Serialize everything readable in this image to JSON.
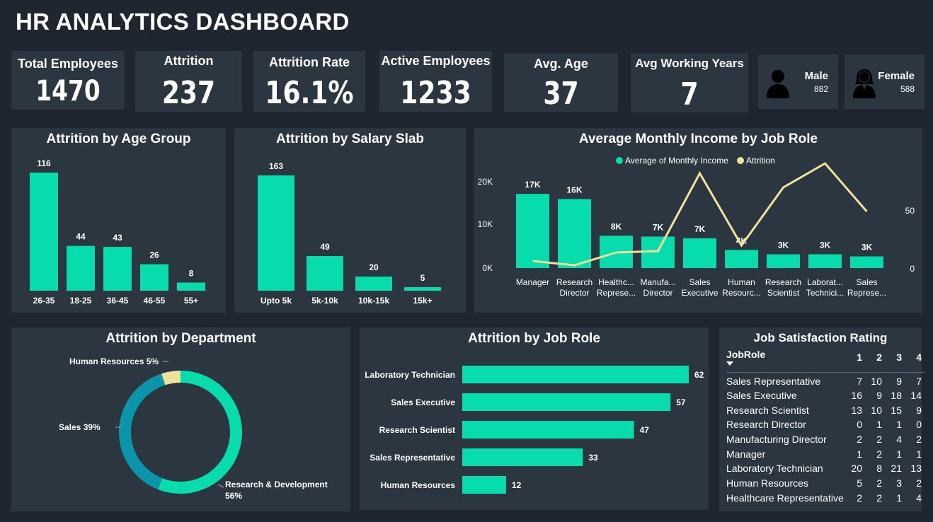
{
  "page": {
    "title": "HR ANALYTICS DASHBOARD"
  },
  "colors": {
    "background": "#1f2630",
    "card": "#2b3640",
    "accent": "#07dcac",
    "line": "#efe39b",
    "donut_sales": "#0b95ab",
    "donut_hr": "#efe39b"
  },
  "kpis": [
    {
      "label": "Total Employees",
      "value": "1470"
    },
    {
      "label": "Attrition",
      "value": "237"
    },
    {
      "label": "Attrition Rate",
      "value": "16.1%"
    },
    {
      "label": "Active Employees",
      "value": "1233"
    },
    {
      "label": "Avg. Age",
      "value": "37"
    },
    {
      "label": "Avg Working Years",
      "value": "7"
    }
  ],
  "gender": {
    "male": {
      "label": "Male",
      "value": "882",
      "icon": "male-user-icon"
    },
    "female": {
      "label": "Female",
      "value": "588",
      "icon": "female-user-icon"
    }
  },
  "chart_data": [
    {
      "type": "bar",
      "title": "Attrition by Age Group",
      "categories": [
        "26-35",
        "18-25",
        "36-45",
        "46-55",
        "55+"
      ],
      "values": [
        116,
        44,
        43,
        26,
        8
      ]
    },
    {
      "type": "bar",
      "title": "Attrition by Salary Slab",
      "categories": [
        "Upto 5k",
        "5k-10k",
        "10k-15k",
        "15k+"
      ],
      "values": [
        163,
        49,
        20,
        5
      ]
    },
    {
      "type": "bar",
      "title": "Average Monthly Income by Job Role",
      "categories": [
        "Manager",
        "Research Director",
        "Healthc... Represe...",
        "Manufa... Director",
        "Sales Executive",
        "Human Resourc...",
        "Research Scientist",
        "Laborat... Technici...",
        "Sales Represe..."
      ],
      "legend": [
        "Average of Monthly Income",
        "Attrition"
      ],
      "y_ticks_left": [
        "20K",
        "10K",
        "0K"
      ],
      "y_ticks_right": [
        "50",
        "0"
      ],
      "ylim_left": [
        0,
        20000
      ],
      "ylim_right": [
        0,
        60
      ],
      "series": [
        {
          "name": "Average of Monthly Income",
          "type": "bar",
          "values": [
            17200,
            16000,
            7500,
            7300,
            6900,
            4200,
            3200,
            3200,
            2700
          ],
          "labels": [
            "17K",
            "16K",
            "8K",
            "7K",
            "7K",
            "4K",
            "3K",
            "3K",
            "3K"
          ]
        },
        {
          "name": "Attrition",
          "type": "line",
          "values": [
            5,
            2,
            11,
            12,
            67,
            16,
            57,
            74,
            40
          ]
        }
      ]
    },
    {
      "type": "pie",
      "title": "Attrition by Department",
      "categories": [
        "Research & Development",
        "Sales",
        "Human Resources"
      ],
      "values": [
        56,
        39,
        5
      ],
      "labels": [
        "Research & Development",
        "56%",
        "Sales 39%",
        "Human Resources 5%"
      ]
    },
    {
      "type": "bar",
      "title": "Attrition by Job Role",
      "categories": [
        "Laboratory Technician",
        "Sales Executive",
        "Research Scientist",
        "Sales Representative",
        "Human Resources"
      ],
      "values": [
        62,
        57,
        47,
        33,
        12
      ]
    },
    {
      "type": "table",
      "title": "Job Satisfaction Rating",
      "columns": [
        "JobRole",
        "1",
        "2",
        "3",
        "4"
      ],
      "rows": [
        [
          "Sales Representative",
          "7",
          "10",
          "9",
          "7"
        ],
        [
          "Sales Executive",
          "16",
          "9",
          "18",
          "14"
        ],
        [
          "Research Scientist",
          "13",
          "10",
          "15",
          "9"
        ],
        [
          "Research Director",
          "0",
          "1",
          "1",
          "0"
        ],
        [
          "Manufacturing Director",
          "2",
          "2",
          "4",
          "2"
        ],
        [
          "Manager",
          "1",
          "2",
          "1",
          "1"
        ],
        [
          "Laboratory Technician",
          "20",
          "8",
          "21",
          "13"
        ],
        [
          "Human Resources",
          "5",
          "2",
          "3",
          "2"
        ],
        [
          "Healthcare Representative",
          "2",
          "2",
          "1",
          "4"
        ]
      ]
    }
  ]
}
